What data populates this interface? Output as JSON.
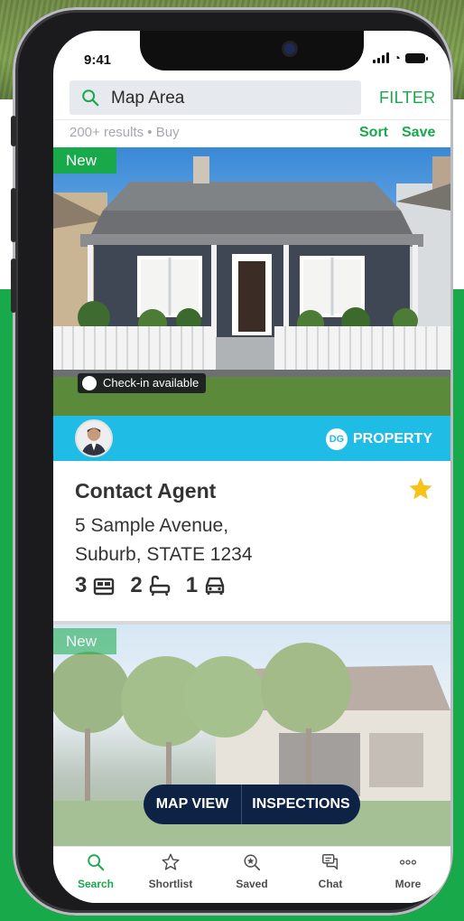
{
  "status": {
    "time": "9:41"
  },
  "search": {
    "query": "Map Area",
    "filter_label": "FILTER"
  },
  "results": {
    "summary": "200+ results • Buy",
    "sort_label": "Sort",
    "save_label": "Save"
  },
  "listing_1": {
    "badge": "New",
    "checkin": "Check-in available",
    "agency": "PROPERTY",
    "agency_logo": "DG",
    "price": "Contact Agent",
    "address_line1": "5 Sample Avenue,",
    "address_line2": "Suburb, STATE 1234",
    "bedrooms": "3",
    "bathrooms": "2",
    "parking": "1",
    "shortlisted": true
  },
  "listing_2": {
    "badge": "New"
  },
  "floating_actions": {
    "map_view": "MAP VIEW",
    "inspections": "INSPECTIONS"
  },
  "tabs": [
    {
      "label": "Search",
      "icon": "search-icon",
      "active": true
    },
    {
      "label": "Shortlist",
      "icon": "star-outline-icon",
      "active": false
    },
    {
      "label": "Saved",
      "icon": "saved-search-icon",
      "active": false
    },
    {
      "label": "Chat",
      "icon": "chat-icon",
      "active": false
    },
    {
      "label": "More",
      "icon": "more-icon",
      "active": false
    }
  ],
  "colors": {
    "accent": "#18a94a",
    "agency_bar": "#1fbce6",
    "fab": "#0d2244",
    "star": "#f6c31a"
  }
}
